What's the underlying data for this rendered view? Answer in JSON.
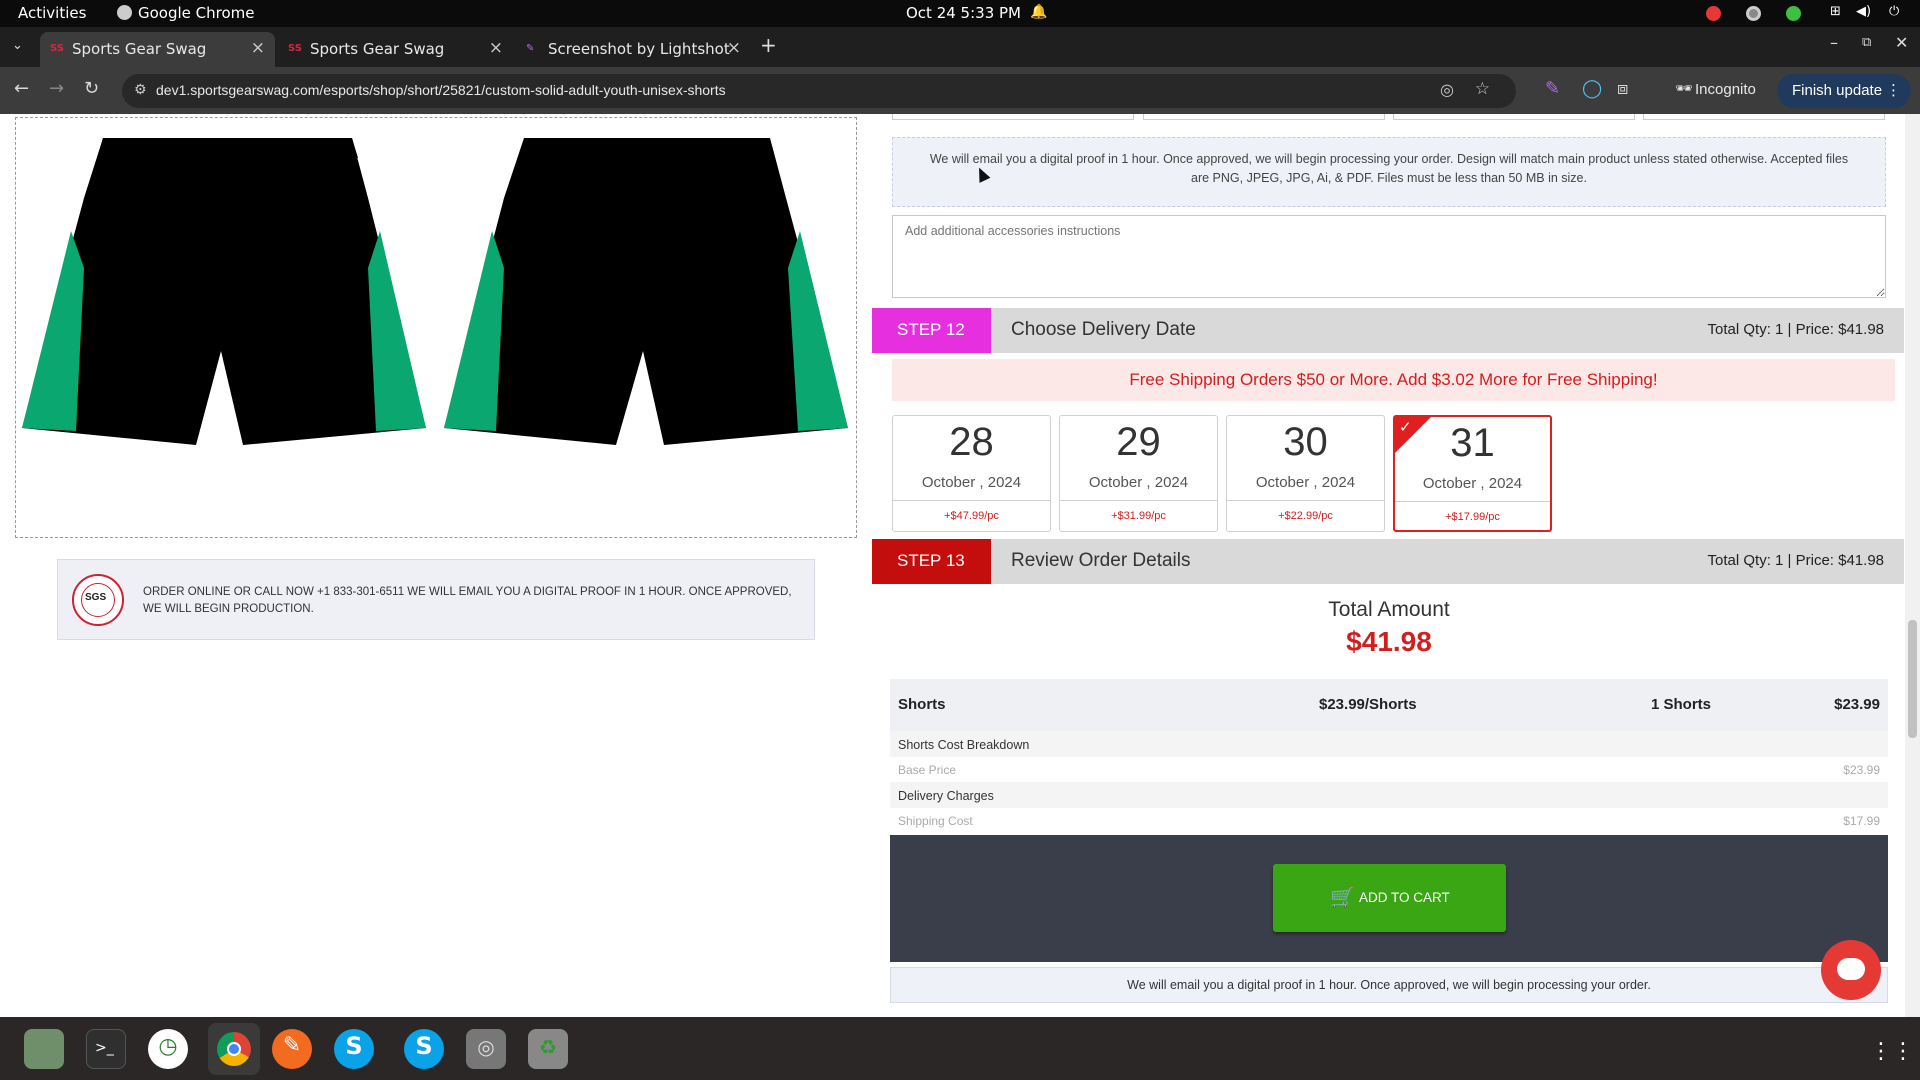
{
  "system": {
    "activities": "Activities",
    "app_name": "Google Chrome",
    "datetime": "Oct 24  5:33 PM"
  },
  "browser": {
    "tabs": [
      {
        "title": "Sports Gear Swag",
        "active": true
      },
      {
        "title": "Sports Gear Swag",
        "active": false
      },
      {
        "title": "Screenshot by Lightshot",
        "active": false
      }
    ],
    "url": "dev1.sportsgearswag.com/esports/shop/short/25821/custom-solid-adult-youth-unisex-shorts",
    "incognito_label": "Incognito",
    "finish_update_label": "Finish update"
  },
  "left": {
    "banner_text": "ORDER ONLINE OR CALL NOW +1 833-301-6511 WE WILL EMAIL YOU A DIGITAL PROOF IN 1 HOUR. ONCE APPROVED, WE WILL BEGIN PRODUCTION.",
    "seal_text": "SGS"
  },
  "accessories": {
    "notice": "We will email you a digital proof in 1 hour. Once approved, we will begin processing your order. Design will match main product unless stated otherwise. Accepted files are PNG, JPEG, JPG, Ai, & PDF. Files must be less than 50 MB in size.",
    "instructions_placeholder": "Add additional accessories instructions"
  },
  "step12": {
    "tag": "STEP 12",
    "title": "Choose Delivery Date",
    "qty_price": "Total Qty: 1 | Price: $41.98",
    "shipping_banner": "Free Shipping Orders $50 or More. Add $3.02 More for Free Shipping!",
    "dates": [
      {
        "day": "28",
        "month": "October , 2024",
        "price": "+$47.99/pc",
        "selected": false
      },
      {
        "day": "29",
        "month": "October , 2024",
        "price": "+$31.99/pc",
        "selected": false
      },
      {
        "day": "30",
        "month": "October , 2024",
        "price": "+$22.99/pc",
        "selected": false
      },
      {
        "day": "31",
        "month": "October , 2024",
        "price": "+$17.99/pc",
        "selected": true
      }
    ]
  },
  "step13": {
    "tag": "STEP 13",
    "title": "Review Order Details",
    "qty_price": "Total Qty: 1 | Price: $41.98",
    "total_label": "Total Amount",
    "total_value": "$41.98",
    "item": {
      "name": "Shorts",
      "unit_price": "$23.99/Shorts",
      "qty": "1 Shorts",
      "subtotal": "$23.99"
    },
    "breakdown_label": "Shorts Cost Breakdown",
    "base_price_label": "Base Price",
    "base_price_value": "$23.99",
    "delivery_label": "Delivery Charges",
    "shipping_label": "Shipping Cost",
    "shipping_value": "$17.99",
    "add_to_cart": "ADD TO CART",
    "footer_note": "We will email you a digital proof in 1 hour. Once approved, we will begin processing your order."
  },
  "colors": {
    "step12": "#e630e0",
    "step13": "#c40d0d",
    "add_to_cart": "#3aa614",
    "price_red": "#d21e1e",
    "shorts_green": "#0aa870"
  }
}
